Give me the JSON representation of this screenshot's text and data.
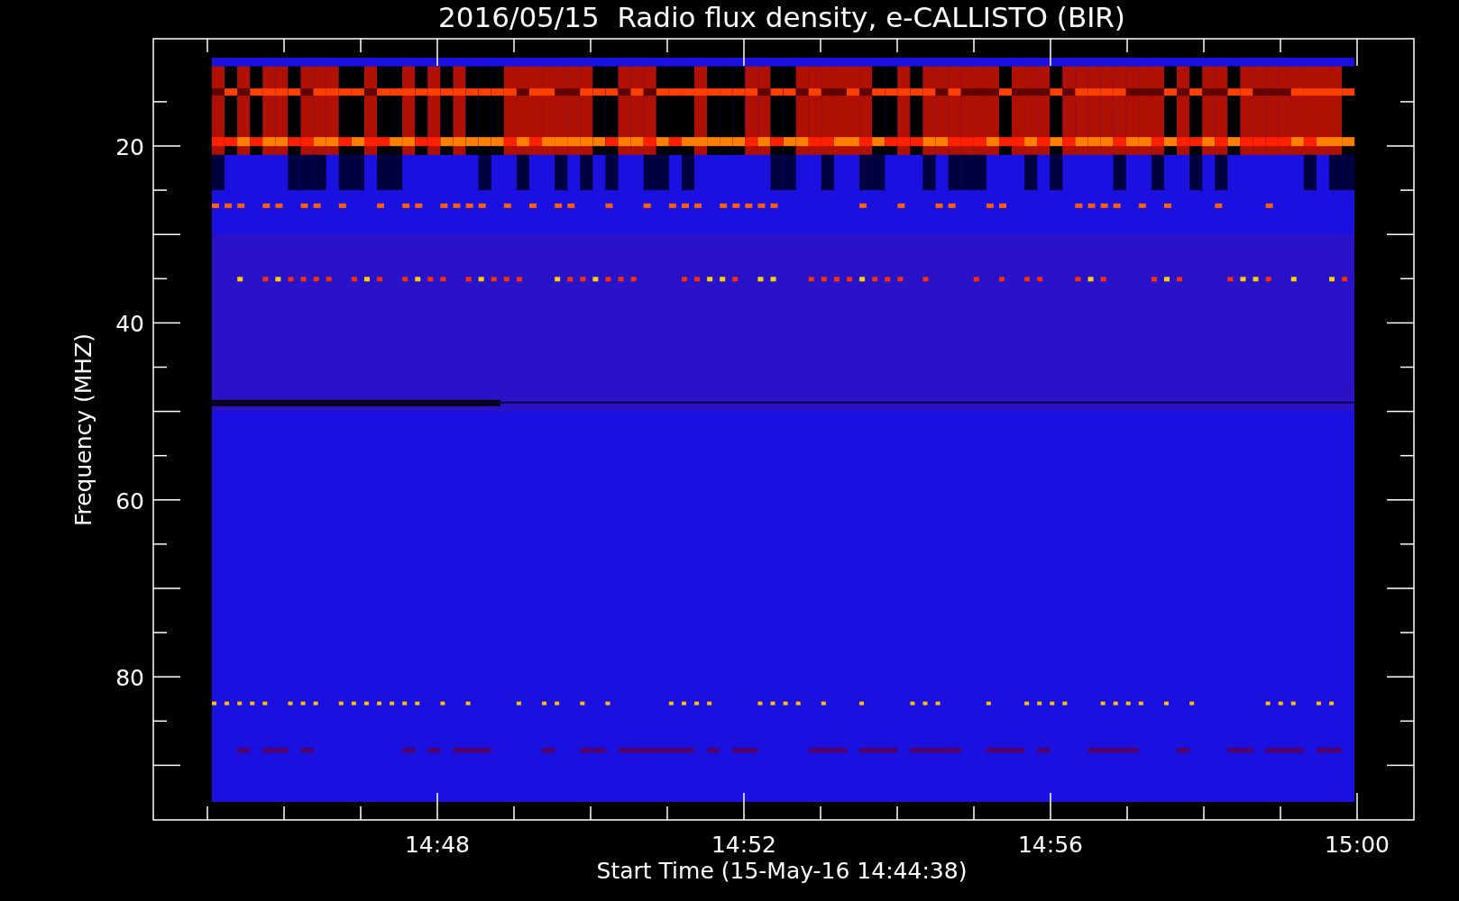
{
  "chart": {
    "title": "2016/05/15  Radio flux density, e-CALLISTO (BIR)",
    "ylabel": "Frequency (MHZ)",
    "yticks": [
      "20",
      "40",
      "60",
      "80"
    ],
    "xlabel": "Start Time (15-May-16 14:44:38)",
    "xticks": [
      "14:48",
      "14:52",
      "14:56",
      "15:00"
    ]
  }
}
